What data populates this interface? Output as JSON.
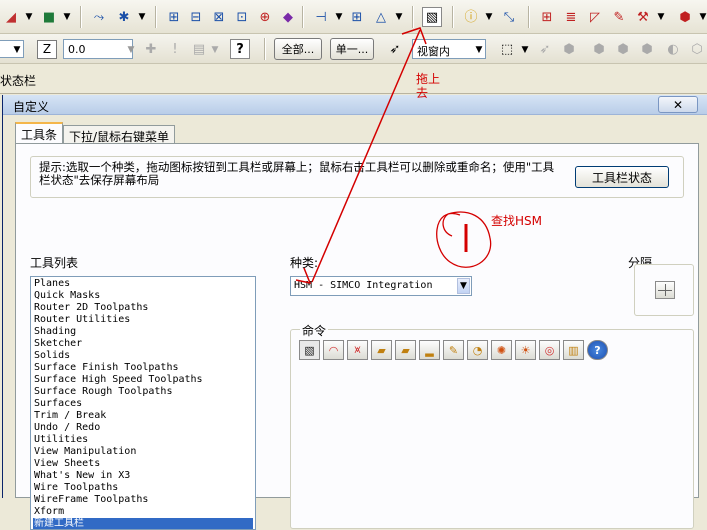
{
  "toolbar_top": {
    "icons": [
      "surface-icon",
      "solid-block-icon",
      "toolpath-icon",
      "axis-icon",
      "grid-icon",
      "align-icon",
      "layout-icon",
      "group-icon",
      "plus-icon",
      "shape-icon",
      "drill-icon",
      "transform-icon",
      "chamfer-icon",
      "hsm-icon",
      "info-icon",
      "resize-icon",
      "table-icon",
      "list-icon",
      "dimension-icon",
      "pencil-icon",
      "wrench-icon",
      "cube-icon"
    ]
  },
  "toolbar_second": {
    "z_label": "Z",
    "z_value": "0.0",
    "btn_all": "全部...",
    "btn_single": "单一...",
    "view_combo": "视窗内"
  },
  "status_label": "状态栏",
  "dialog": {
    "title": "自定义",
    "tabs": [
      "工具条",
      "下拉/鼠标右键菜单"
    ],
    "hint": "提示:选取一个种类，拖动图标按钮到工具栏或屏幕上；鼠标右击工具栏可以删除或重命名；使用\"工具栏状态\"去保存屏幕布局",
    "toolbar_status_button": "工具栏状态",
    "toolbar_list_label": "工具列表",
    "toolbar_list": [
      "Planes",
      "Quick Masks",
      "Router 2D Toolpaths",
      "Router Utilities",
      "Shading",
      "Sketcher",
      "Solids",
      "Surface Finish Toolpaths",
      "Surface High Speed Toolpaths",
      "Surface Rough Toolpaths",
      "Surfaces",
      "Trim / Break",
      "Undo / Redo",
      "Utilities",
      "View Manipulation",
      "View Sheets",
      "What's New in X3",
      "Wire Toolpaths",
      "WireFrame Toolpaths",
      "Xform",
      "新建工具栏"
    ],
    "selected_item": "新建工具栏",
    "category_label": "种类:",
    "category_value": "HSM - SIMCO Integration",
    "divider_label": "分隔",
    "commands_label": "命令",
    "command_icons": [
      "hsm-drill-icon",
      "raster-icon",
      "contour-icon",
      "pocket-icon",
      "parallel-icon",
      "flat-icon",
      "pencil-trace-icon",
      "rest-icon",
      "morph-icon",
      "radial-icon",
      "spiral-icon",
      "scallop-icon",
      "help-icon"
    ]
  },
  "annotations": {
    "drag_up": "拖上去",
    "find_hsm": "查找HSM"
  },
  "colors": {
    "annotation": "#d40000",
    "selection": "#316ac5"
  }
}
